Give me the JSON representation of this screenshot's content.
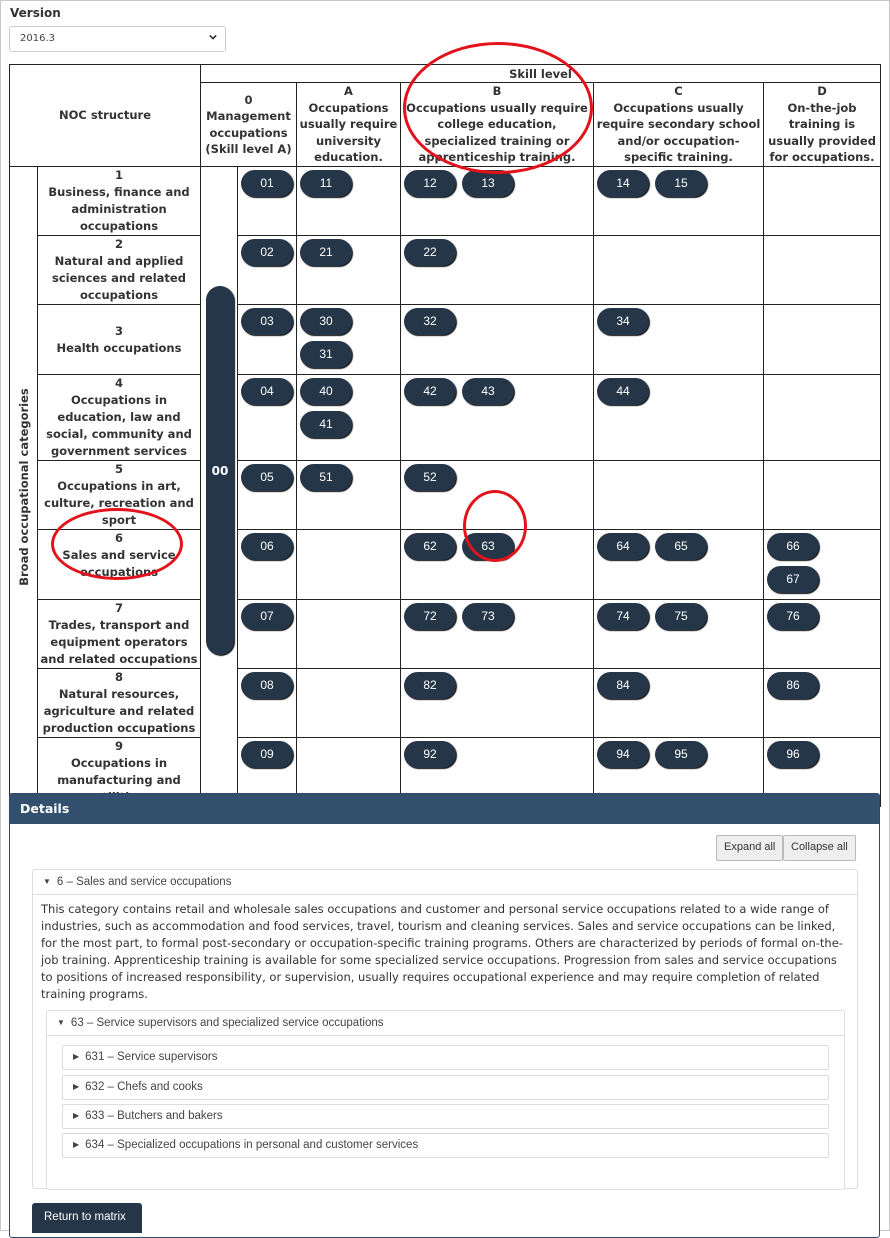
{
  "version": {
    "label": "Version",
    "selected": "2016.3"
  },
  "matrix": {
    "noc_structure_label": "NOC structure",
    "skill_level_label": "Skill level",
    "broad_categories_label": "Broad occupational categories",
    "columns": [
      {
        "code": "0",
        "desc": "Management occupations (Skill level A)"
      },
      {
        "code": "A",
        "desc": "Occupations usually require university education."
      },
      {
        "code": "B",
        "desc": "Occupations usually require college education, specialized training or apprenticeship training."
      },
      {
        "code": "C",
        "desc": "Occupations usually require secondary school and/or occupation-specific training."
      },
      {
        "code": "D",
        "desc": "On-the-job training is usually provided for occupations."
      }
    ],
    "senior_management_code": "00",
    "rows": [
      {
        "code": "1",
        "name": "Business, finance and administration occupations",
        "zero": "01",
        "A": [
          "11"
        ],
        "B": [
          "12",
          "13"
        ],
        "C": [
          "14",
          "15"
        ],
        "D": []
      },
      {
        "code": "2",
        "name": "Natural and applied sciences and related occupations",
        "zero": "02",
        "A": [
          "21"
        ],
        "B": [
          "22"
        ],
        "C": [],
        "D": []
      },
      {
        "code": "3",
        "name": "Health occupations",
        "zero": "03",
        "A": [
          "30",
          "31"
        ],
        "B": [
          "32"
        ],
        "C": [
          "34"
        ],
        "D": []
      },
      {
        "code": "4",
        "name": "Occupations in education, law and social, community and government services",
        "zero": "04",
        "A": [
          "40",
          "41"
        ],
        "B": [
          "42",
          "43"
        ],
        "C": [
          "44"
        ],
        "D": []
      },
      {
        "code": "5",
        "name": "Occupations in art, culture, recreation and sport",
        "zero": "05",
        "A": [
          "51"
        ],
        "B": [
          "52"
        ],
        "C": [],
        "D": []
      },
      {
        "code": "6",
        "name": "Sales and service occupations",
        "zero": "06",
        "A": [],
        "B": [
          "62",
          "63"
        ],
        "C": [
          "64",
          "65"
        ],
        "D": [
          "66",
          "67"
        ]
      },
      {
        "code": "7",
        "name": "Trades, transport and equipment operators and related occupations",
        "zero": "07",
        "A": [],
        "B": [
          "72",
          "73"
        ],
        "C": [
          "74",
          "75"
        ],
        "D": [
          "76"
        ]
      },
      {
        "code": "8",
        "name": "Natural resources, agriculture and related production occupations",
        "zero": "08",
        "A": [],
        "B": [
          "82"
        ],
        "C": [
          "84"
        ],
        "D": [
          "86"
        ]
      },
      {
        "code": "9",
        "name": "Occupations in manufacturing and utilities",
        "zero": "09",
        "A": [],
        "B": [
          "92"
        ],
        "C": [
          "94",
          "95"
        ],
        "D": [
          "96"
        ]
      }
    ]
  },
  "details": {
    "title": "Details",
    "expand_all": "Expand all",
    "collapse_all": "Collapse all",
    "category": {
      "title": "6 – Sales and service occupations",
      "description": "This category contains retail and wholesale sales occupations and customer and personal service occupations related to a wide range of industries, such as accommodation and food services, travel, tourism and cleaning services. Sales and service occupations can be linked, for the most part, to formal post-secondary or occupation-specific training programs. Others are characterized by periods of formal on-the-job training. Apprenticeship training is available for some specialized service occupations. Progression from sales and service occupations to positions of increased responsibility, or supervision, usually requires occupational experience and may require completion of related training programs."
    },
    "major_group": {
      "title": "63 – Service supervisors and specialized service occupations",
      "items": [
        "631 – Service supervisors",
        "632 – Chefs and cooks",
        "633 – Butchers and bakers",
        "634 – Specialized occupations in personal and customer services"
      ]
    },
    "return_button": "Return to matrix"
  },
  "colors": {
    "pill": "#253649",
    "details_header": "#33506f",
    "annotation": "#e3121b"
  }
}
